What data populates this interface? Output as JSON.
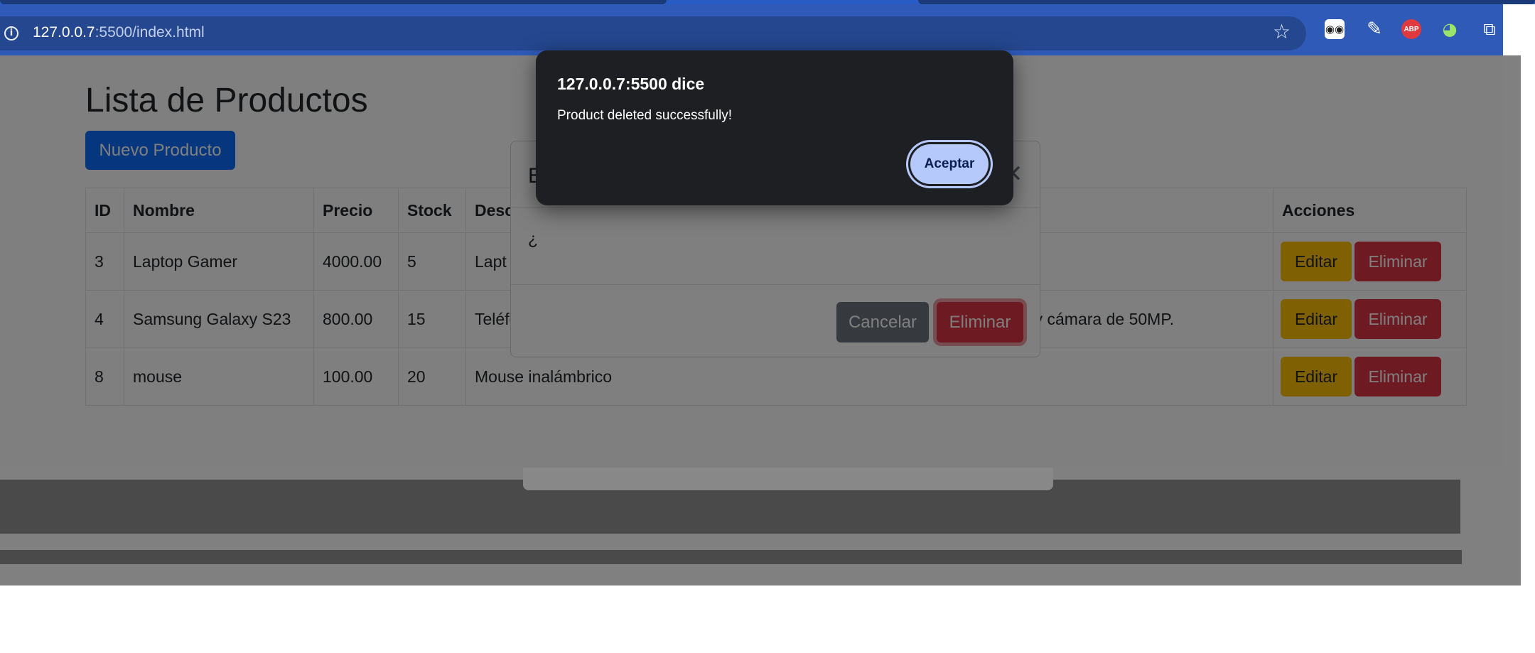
{
  "browser": {
    "url_host": "127.0.0.7",
    "url_rest": ":5500/index.html"
  },
  "page": {
    "title": "Lista de Productos",
    "new_button": "Nuevo Producto",
    "table": {
      "headers": [
        "ID",
        "Nombre",
        "Precio",
        "Stock",
        "Desc",
        "Acciones"
      ],
      "rows": [
        {
          "id": "3",
          "name": "Laptop Gamer",
          "price": "4000.00",
          "stock": "5",
          "desc": "Lapt",
          "edit": "Editar",
          "delete": "Eliminar"
        },
        {
          "id": "4",
          "name": "Samsung Galaxy S23",
          "price": "800.00",
          "stock": "15",
          "desc": "Teléfono con pantalla AMOLED de 6.5 pulgadas, 128GB de almacenamiento y cámara de 50MP.",
          "edit": "Editar",
          "delete": "Eliminar"
        },
        {
          "id": "8",
          "name": "mouse",
          "price": "100.00",
          "stock": "20",
          "desc": "Mouse inalámbrico",
          "edit": "Editar",
          "delete": "Eliminar"
        }
      ]
    }
  },
  "modal": {
    "title_partial": "E",
    "body_partial": "¿",
    "close_glyph": "✕",
    "cancel_label": "Cancelar",
    "confirm_label": "Eliminar"
  },
  "alert": {
    "title": "127.0.0.7:5500 dice",
    "message": "Product deleted successfully!",
    "ok_label": "Aceptar"
  },
  "icons": [
    "site-info-icon",
    "bookmark-star-icon",
    "reader-extension-icon",
    "color-picker-extension-icon",
    "adblock-plus-extension-icon",
    "turtle-extension-icon",
    "extensions-puzzle-icon",
    "side-panel-icon",
    "close-icon"
  ],
  "colors": {
    "browser_toolbar": "#2f5ab8",
    "primary": "#0d6efd",
    "warning": "#ffc107",
    "danger": "#dc3545",
    "secondary": "#6c757d",
    "alert_bg": "#1e1f23",
    "alert_button": "#b5c9fb"
  }
}
